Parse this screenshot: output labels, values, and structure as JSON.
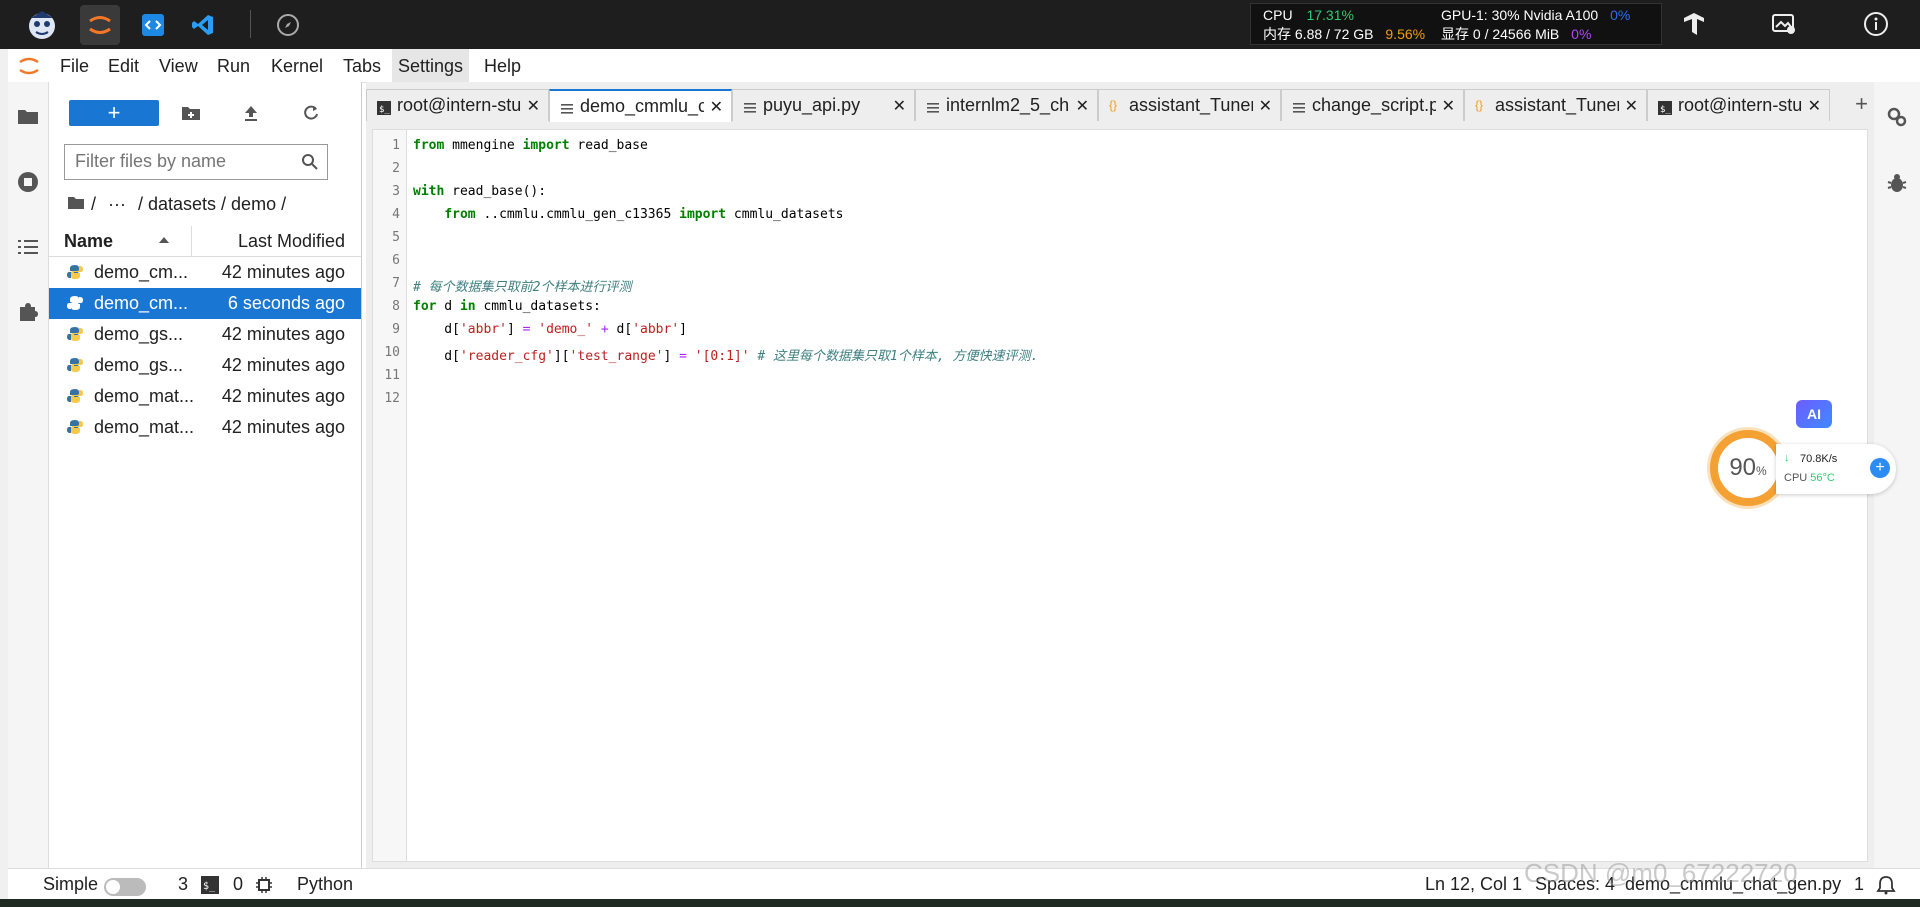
{
  "system_monitor": {
    "cpu_label": "CPU",
    "cpu_value": "17.31%",
    "gpu_label": "GPU-1: 30% Nvidia A100",
    "gpu_value": "0%",
    "mem_label": "内存 6.88 / 72 GB",
    "mem_value": "9.56%",
    "vram_label": "显存 0 / 24566 MiB",
    "vram_value": "0%",
    "colors": {
      "cpu": "#2ecc71",
      "mem": "#f39c12",
      "gpu": "#2c6cf4",
      "vram": "#b04af0"
    }
  },
  "top_apps": [
    "mascot-icon",
    "jupyter-icon",
    "code-icon",
    "vscode-icon",
    "compass-icon"
  ],
  "menu": [
    "File",
    "Edit",
    "View",
    "Run",
    "Kernel",
    "Tabs",
    "Settings",
    "Help"
  ],
  "file_browser": {
    "new_button": "+",
    "filter_placeholder": "Filter files by name",
    "breadcrumb": [
      "/",
      "···",
      "/ datasets / demo /"
    ],
    "col_name": "Name",
    "col_modified": "Last Modified",
    "files": [
      {
        "name": "demo_cm...",
        "modified": "42 minutes ago",
        "selected": false
      },
      {
        "name": "demo_cm...",
        "modified": "6 seconds ago",
        "selected": true
      },
      {
        "name": "demo_gs...",
        "modified": "42 minutes ago",
        "selected": false
      },
      {
        "name": "demo_gs...",
        "modified": "42 minutes ago",
        "selected": false
      },
      {
        "name": "demo_mat...",
        "modified": "42 minutes ago",
        "selected": false
      },
      {
        "name": "demo_mat...",
        "modified": "42 minutes ago",
        "selected": false
      }
    ]
  },
  "tabs": [
    {
      "label": "root@intern-stu",
      "icon": "terminal-icon",
      "active": false
    },
    {
      "label": "demo_cmmlu_c",
      "icon": "text-file-icon",
      "active": true
    },
    {
      "label": "puyu_api.py",
      "icon": "text-file-icon",
      "active": false
    },
    {
      "label": "internlm2_5_cha",
      "icon": "text-file-icon",
      "active": false
    },
    {
      "label": "assistant_Tuner.",
      "icon": "json-icon",
      "active": false
    },
    {
      "label": "change_script.p",
      "icon": "text-file-icon",
      "active": false
    },
    {
      "label": "assistant_Tuner.",
      "icon": "json-icon",
      "active": false
    },
    {
      "label": "root@intern-stu",
      "icon": "terminal-icon",
      "active": false
    }
  ],
  "add_tab": "+",
  "code": {
    "line_numbers": [
      "1",
      "2",
      "3",
      "4",
      "5",
      "6",
      "7",
      "8",
      "9",
      "10",
      "11",
      "12"
    ],
    "l1": {
      "a": "from",
      "b": " mmengine ",
      "c": "import",
      "d": " read_base"
    },
    "l3": {
      "a": "with",
      "b": " read_base():"
    },
    "l4": {
      "a": "    ",
      "b": "from",
      "c": " ..cmmlu.cmmlu_gen_c13365 ",
      "d": "import",
      "e": " cmmlu_datasets"
    },
    "l7": "# 每个数据集只取前2个样本进行评测",
    "l8": {
      "a": "for",
      "b": " d ",
      "c": "in",
      "d": " cmmlu_datasets:"
    },
    "l9": {
      "a": "    d[",
      "b": "'abbr'",
      "c": "] ",
      "d": "=",
      "e": " ",
      "f": "'demo_'",
      "g": " ",
      "h": "+",
      "i": " d[",
      "j": "'abbr'",
      "k": "]"
    },
    "l10": {
      "a": "    d[",
      "b": "'reader_cfg'",
      "c": "][",
      "d": "'test_range'",
      "e": "] ",
      "f": "=",
      "g": " ",
      "h": "'[0:1]'",
      "i": " ",
      "j": "# 这里每个数据集只取1个样本, 方便快速评测."
    }
  },
  "status": {
    "mode": "Simple",
    "terminals": "3",
    "kernels": "0",
    "kernel_name": "Python",
    "cursor": "Ln 12, Col 1",
    "spaces": "Spaces: 4",
    "filename": "demo_cmmlu_chat_gen.py",
    "notifications": "1"
  },
  "widget": {
    "ai": "AI",
    "percent": "90",
    "percent_sign": "%",
    "speed": "70.8K/s",
    "cpu_label": "CPU",
    "cpu_temp": "56°C",
    "plus": "+"
  },
  "watermark": "CSDN @m0_67222720"
}
